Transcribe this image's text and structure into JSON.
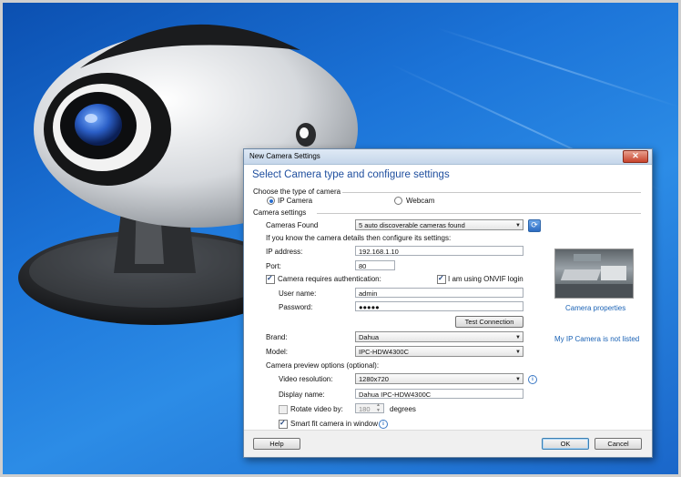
{
  "dialog": {
    "title": "New Camera Settings",
    "close_label": "✕",
    "header": "Select Camera type and configure settings"
  },
  "camera_type": {
    "section_label": "Choose the type of camera",
    "options": [
      {
        "label": "IP Camera",
        "selected": true
      },
      {
        "label": "Webcam",
        "selected": false
      }
    ]
  },
  "camera_settings": {
    "section_label": "Camera settings",
    "cameras_found_label": "Cameras Found",
    "cameras_found_value": "5 auto discoverable cameras found",
    "hint": "If you know the camera details then configure its settings:",
    "ip_label": "IP address:",
    "ip_value": "192.168.1.10",
    "port_label": "Port:",
    "port_value": "80",
    "auth_label": "Camera requires authentication:",
    "auth_checked": true,
    "onvif_label": "I am using ONVIF login",
    "onvif_checked": true,
    "username_label": "User name:",
    "username_value": "admin",
    "password_label": "Password:",
    "password_value": "●●●●●",
    "test_button": "Test Connection",
    "brand_label": "Brand:",
    "brand_value": "Dahua",
    "model_label": "Model:",
    "model_value": "IPC-HDW4300C"
  },
  "preview_options": {
    "section_label": "Camera preview options (optional):",
    "resolution_label": "Video resolution:",
    "resolution_value": "1280x720",
    "display_name_label": "Display name:",
    "display_name_value": "Dahua IPC-HDW4300C",
    "rotate_label": "Rotate video by:",
    "rotate_checked": false,
    "rotate_value": "180",
    "rotate_unit": "degrees",
    "smart_fit_label": "Smart fit camera in window",
    "smart_fit_checked": true
  },
  "side_panel": {
    "camera_properties_link": "Camera properties",
    "not_listed_link": "My IP Camera is not listed"
  },
  "footer": {
    "help": "Help",
    "ok": "OK",
    "cancel": "Cancel"
  },
  "colors": {
    "desktop_blue": "#1c74d8",
    "header_text": "#1e4e9e",
    "link": "#1a62b5"
  }
}
